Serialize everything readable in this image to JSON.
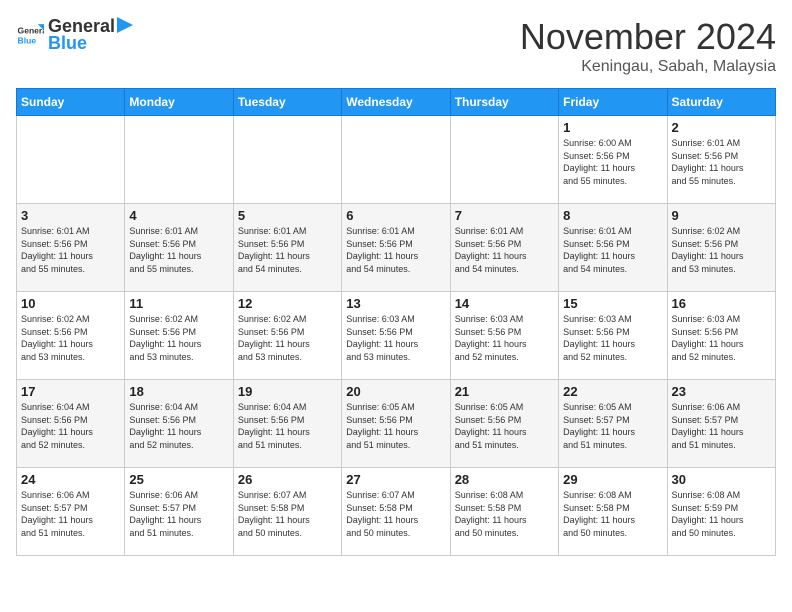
{
  "logo": {
    "general": "General",
    "blue": "Blue"
  },
  "header": {
    "month": "November 2024",
    "location": "Keningau, Sabah, Malaysia"
  },
  "weekdays": [
    "Sunday",
    "Monday",
    "Tuesday",
    "Wednesday",
    "Thursday",
    "Friday",
    "Saturday"
  ],
  "weeks": [
    [
      {
        "day": "",
        "info": ""
      },
      {
        "day": "",
        "info": ""
      },
      {
        "day": "",
        "info": ""
      },
      {
        "day": "",
        "info": ""
      },
      {
        "day": "",
        "info": ""
      },
      {
        "day": "1",
        "info": "Sunrise: 6:00 AM\nSunset: 5:56 PM\nDaylight: 11 hours\nand 55 minutes."
      },
      {
        "day": "2",
        "info": "Sunrise: 6:01 AM\nSunset: 5:56 PM\nDaylight: 11 hours\nand 55 minutes."
      }
    ],
    [
      {
        "day": "3",
        "info": "Sunrise: 6:01 AM\nSunset: 5:56 PM\nDaylight: 11 hours\nand 55 minutes."
      },
      {
        "day": "4",
        "info": "Sunrise: 6:01 AM\nSunset: 5:56 PM\nDaylight: 11 hours\nand 55 minutes."
      },
      {
        "day": "5",
        "info": "Sunrise: 6:01 AM\nSunset: 5:56 PM\nDaylight: 11 hours\nand 54 minutes."
      },
      {
        "day": "6",
        "info": "Sunrise: 6:01 AM\nSunset: 5:56 PM\nDaylight: 11 hours\nand 54 minutes."
      },
      {
        "day": "7",
        "info": "Sunrise: 6:01 AM\nSunset: 5:56 PM\nDaylight: 11 hours\nand 54 minutes."
      },
      {
        "day": "8",
        "info": "Sunrise: 6:01 AM\nSunset: 5:56 PM\nDaylight: 11 hours\nand 54 minutes."
      },
      {
        "day": "9",
        "info": "Sunrise: 6:02 AM\nSunset: 5:56 PM\nDaylight: 11 hours\nand 53 minutes."
      }
    ],
    [
      {
        "day": "10",
        "info": "Sunrise: 6:02 AM\nSunset: 5:56 PM\nDaylight: 11 hours\nand 53 minutes."
      },
      {
        "day": "11",
        "info": "Sunrise: 6:02 AM\nSunset: 5:56 PM\nDaylight: 11 hours\nand 53 minutes."
      },
      {
        "day": "12",
        "info": "Sunrise: 6:02 AM\nSunset: 5:56 PM\nDaylight: 11 hours\nand 53 minutes."
      },
      {
        "day": "13",
        "info": "Sunrise: 6:03 AM\nSunset: 5:56 PM\nDaylight: 11 hours\nand 53 minutes."
      },
      {
        "day": "14",
        "info": "Sunrise: 6:03 AM\nSunset: 5:56 PM\nDaylight: 11 hours\nand 52 minutes."
      },
      {
        "day": "15",
        "info": "Sunrise: 6:03 AM\nSunset: 5:56 PM\nDaylight: 11 hours\nand 52 minutes."
      },
      {
        "day": "16",
        "info": "Sunrise: 6:03 AM\nSunset: 5:56 PM\nDaylight: 11 hours\nand 52 minutes."
      }
    ],
    [
      {
        "day": "17",
        "info": "Sunrise: 6:04 AM\nSunset: 5:56 PM\nDaylight: 11 hours\nand 52 minutes."
      },
      {
        "day": "18",
        "info": "Sunrise: 6:04 AM\nSunset: 5:56 PM\nDaylight: 11 hours\nand 52 minutes."
      },
      {
        "day": "19",
        "info": "Sunrise: 6:04 AM\nSunset: 5:56 PM\nDaylight: 11 hours\nand 51 minutes."
      },
      {
        "day": "20",
        "info": "Sunrise: 6:05 AM\nSunset: 5:56 PM\nDaylight: 11 hours\nand 51 minutes."
      },
      {
        "day": "21",
        "info": "Sunrise: 6:05 AM\nSunset: 5:56 PM\nDaylight: 11 hours\nand 51 minutes."
      },
      {
        "day": "22",
        "info": "Sunrise: 6:05 AM\nSunset: 5:57 PM\nDaylight: 11 hours\nand 51 minutes."
      },
      {
        "day": "23",
        "info": "Sunrise: 6:06 AM\nSunset: 5:57 PM\nDaylight: 11 hours\nand 51 minutes."
      }
    ],
    [
      {
        "day": "24",
        "info": "Sunrise: 6:06 AM\nSunset: 5:57 PM\nDaylight: 11 hours\nand 51 minutes."
      },
      {
        "day": "25",
        "info": "Sunrise: 6:06 AM\nSunset: 5:57 PM\nDaylight: 11 hours\nand 51 minutes."
      },
      {
        "day": "26",
        "info": "Sunrise: 6:07 AM\nSunset: 5:58 PM\nDaylight: 11 hours\nand 50 minutes."
      },
      {
        "day": "27",
        "info": "Sunrise: 6:07 AM\nSunset: 5:58 PM\nDaylight: 11 hours\nand 50 minutes."
      },
      {
        "day": "28",
        "info": "Sunrise: 6:08 AM\nSunset: 5:58 PM\nDaylight: 11 hours\nand 50 minutes."
      },
      {
        "day": "29",
        "info": "Sunrise: 6:08 AM\nSunset: 5:58 PM\nDaylight: 11 hours\nand 50 minutes."
      },
      {
        "day": "30",
        "info": "Sunrise: 6:08 AM\nSunset: 5:59 PM\nDaylight: 11 hours\nand 50 minutes."
      }
    ]
  ]
}
